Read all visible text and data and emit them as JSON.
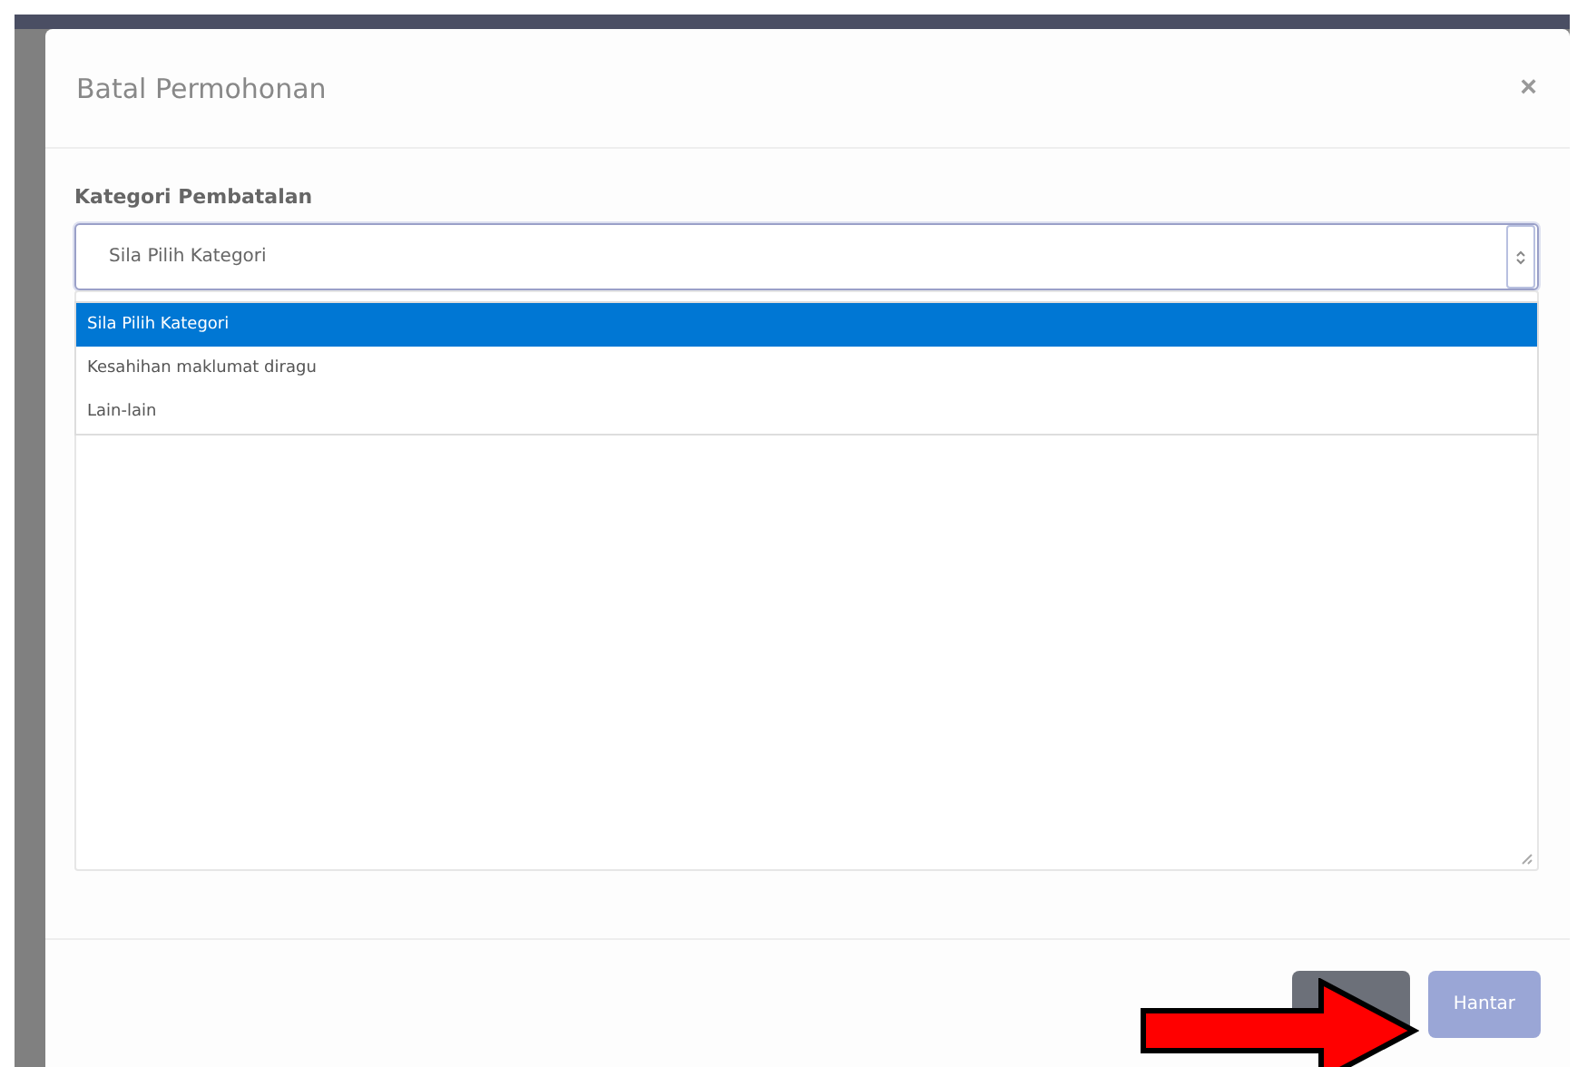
{
  "modal": {
    "title": "Batal Permohonan",
    "close": "×"
  },
  "field": {
    "label": "Kategori Pembatalan",
    "value": "Sila Pilih Kategori",
    "expanded": true,
    "options": [
      {
        "label": "Sila Pilih Kategori",
        "selected": true
      },
      {
        "label": "Kesahihan maklumat diragu",
        "selected": false
      },
      {
        "label": "Lain-lain",
        "selected": false
      }
    ]
  },
  "buttons": [
    {
      "kind": "secondary"
    },
    {
      "kind": "primary",
      "label": "Hantar",
      "disabled": true
    }
  ],
  "annotation": {
    "kind": "arrow"
  }
}
